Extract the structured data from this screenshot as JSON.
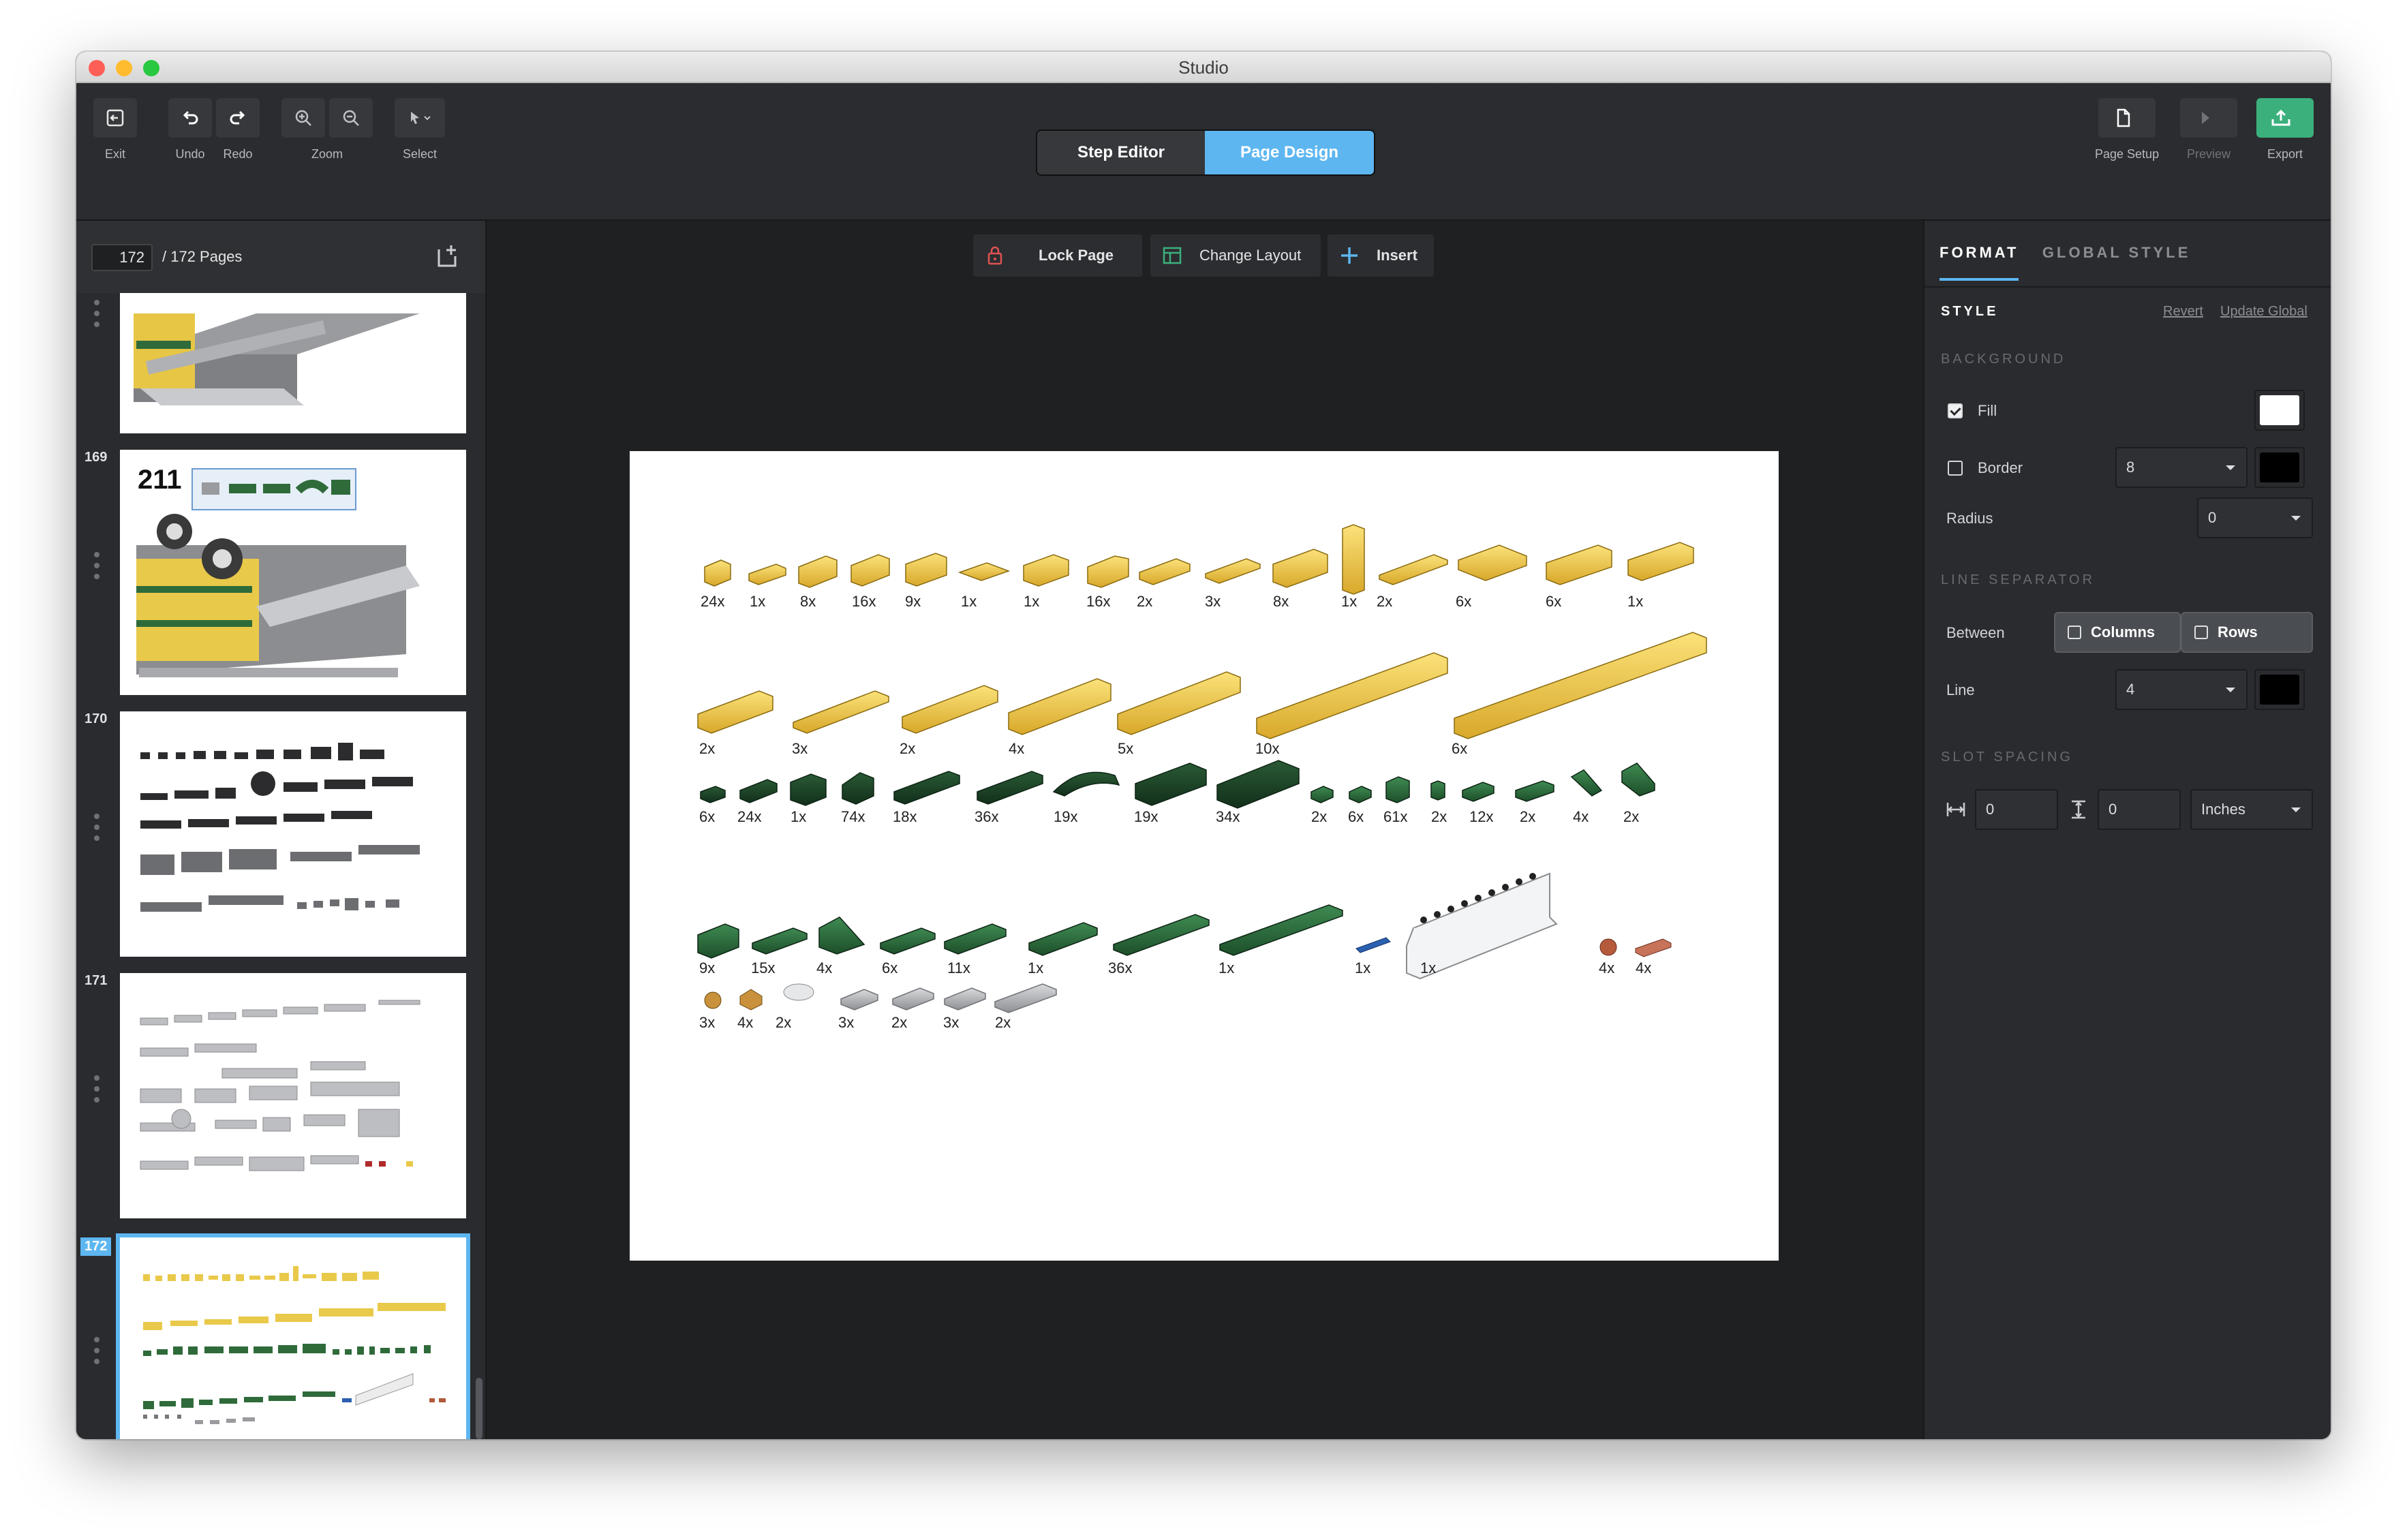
{
  "window": {
    "title": "Studio"
  },
  "toolbar": {
    "exit": "Exit",
    "undo": "Undo",
    "redo": "Redo",
    "zoom": "Zoom",
    "select": "Select",
    "mode_step_editor": "Step Editor",
    "mode_page_design": "Page Design",
    "page_setup": "Page Setup",
    "preview": "Preview",
    "export": "Export"
  },
  "pages": {
    "current": "172",
    "total_label": "/ 172 Pages",
    "thumbnails": [
      {
        "number": ""
      },
      {
        "number": "169",
        "step": "211"
      },
      {
        "number": "170"
      },
      {
        "number": "171"
      },
      {
        "number": "172",
        "selected": true
      }
    ]
  },
  "canvas_tools": {
    "lock_page": "Lock Page",
    "change_layout": "Change Layout",
    "insert": "Insert"
  },
  "parts_list": {
    "row1": [
      "24x",
      "1x",
      "8x",
      "16x",
      "9x",
      "1x",
      "1x",
      "16x",
      "2x",
      "3x",
      "8x",
      "1x",
      "2x",
      "6x",
      "6x",
      "1x"
    ],
    "row2": [
      "2x",
      "3x",
      "2x",
      "4x",
      "5x",
      "10x",
      "6x"
    ],
    "row3": [
      "6x",
      "24x",
      "1x",
      "74x",
      "18x",
      "36x",
      "19x",
      "19x",
      "34x",
      "2x",
      "6x",
      "61x",
      "2x",
      "12x",
      "2x",
      "4x",
      "2x"
    ],
    "row4": [
      "9x",
      "15x",
      "4x",
      "6x",
      "11x",
      "1x",
      "36x",
      "1x",
      "1x",
      "1x",
      "4x",
      "4x"
    ],
    "row5": [
      "3x",
      "4x",
      "2x",
      "3x",
      "2x",
      "3x",
      "2x"
    ]
  },
  "format_panel": {
    "tab_format": "FORMAT",
    "tab_global": "GLOBAL STYLE",
    "style_heading": "STYLE",
    "revert": "Revert",
    "update_global": "Update Global",
    "background_heading": "BACKGROUND",
    "fill_label": "Fill",
    "fill_checked": true,
    "fill_color": "#ffffff",
    "border_label": "Border",
    "border_checked": false,
    "border_value": "8",
    "border_color": "#000000",
    "radius_label": "Radius",
    "radius_value": "0",
    "line_sep_heading": "LINE SEPARATOR",
    "between_label": "Between",
    "columns_label": "Columns",
    "rows_label": "Rows",
    "line_label": "Line",
    "line_value": "4",
    "line_color": "#000000",
    "slot_spacing_heading": "SLOT SPACING",
    "spacing_h": "0",
    "spacing_v": "0",
    "units": "Inches"
  }
}
